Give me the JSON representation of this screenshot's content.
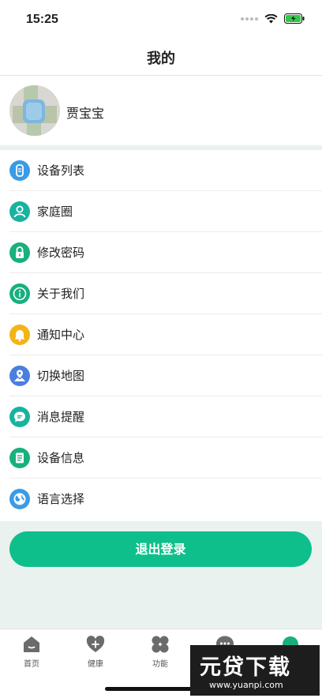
{
  "status_bar": {
    "time": "15:25"
  },
  "header": {
    "title": "我的"
  },
  "profile": {
    "name": "贾宝宝"
  },
  "menu": [
    {
      "label": "设备列表",
      "icon": "watch-icon",
      "color": "#3a9be6"
    },
    {
      "label": "家庭圈",
      "icon": "person-icon",
      "color": "#18b3a0"
    },
    {
      "label": "修改密码",
      "icon": "lock-icon",
      "color": "#17b07e"
    },
    {
      "label": "关于我们",
      "icon": "info-icon",
      "color": "#17b07e"
    },
    {
      "label": "通知中心",
      "icon": "bell-icon",
      "color": "#f3b417"
    },
    {
      "label": "切换地图",
      "icon": "map-icon",
      "color": "#4a7fe0"
    },
    {
      "label": "消息提醒",
      "icon": "message-icon",
      "color": "#18b3a0"
    },
    {
      "label": "设备信息",
      "icon": "document-icon",
      "color": "#17b07e"
    },
    {
      "label": "语言选择",
      "icon": "globe-icon",
      "color": "#3a9be6"
    }
  ],
  "logout": {
    "label": "退出登录",
    "color": "#0fbf8b"
  },
  "tabbar": [
    {
      "label": "首页",
      "icon": "home-icon"
    },
    {
      "label": "健康",
      "icon": "heart-plus-icon"
    },
    {
      "label": "功能",
      "icon": "clover-icon"
    },
    {
      "label": "",
      "icon": "chat-icon"
    },
    {
      "label": "",
      "icon": "profile-icon"
    }
  ],
  "watermark": {
    "title": "元贷下载",
    "url": "www.yuanpi.com"
  }
}
